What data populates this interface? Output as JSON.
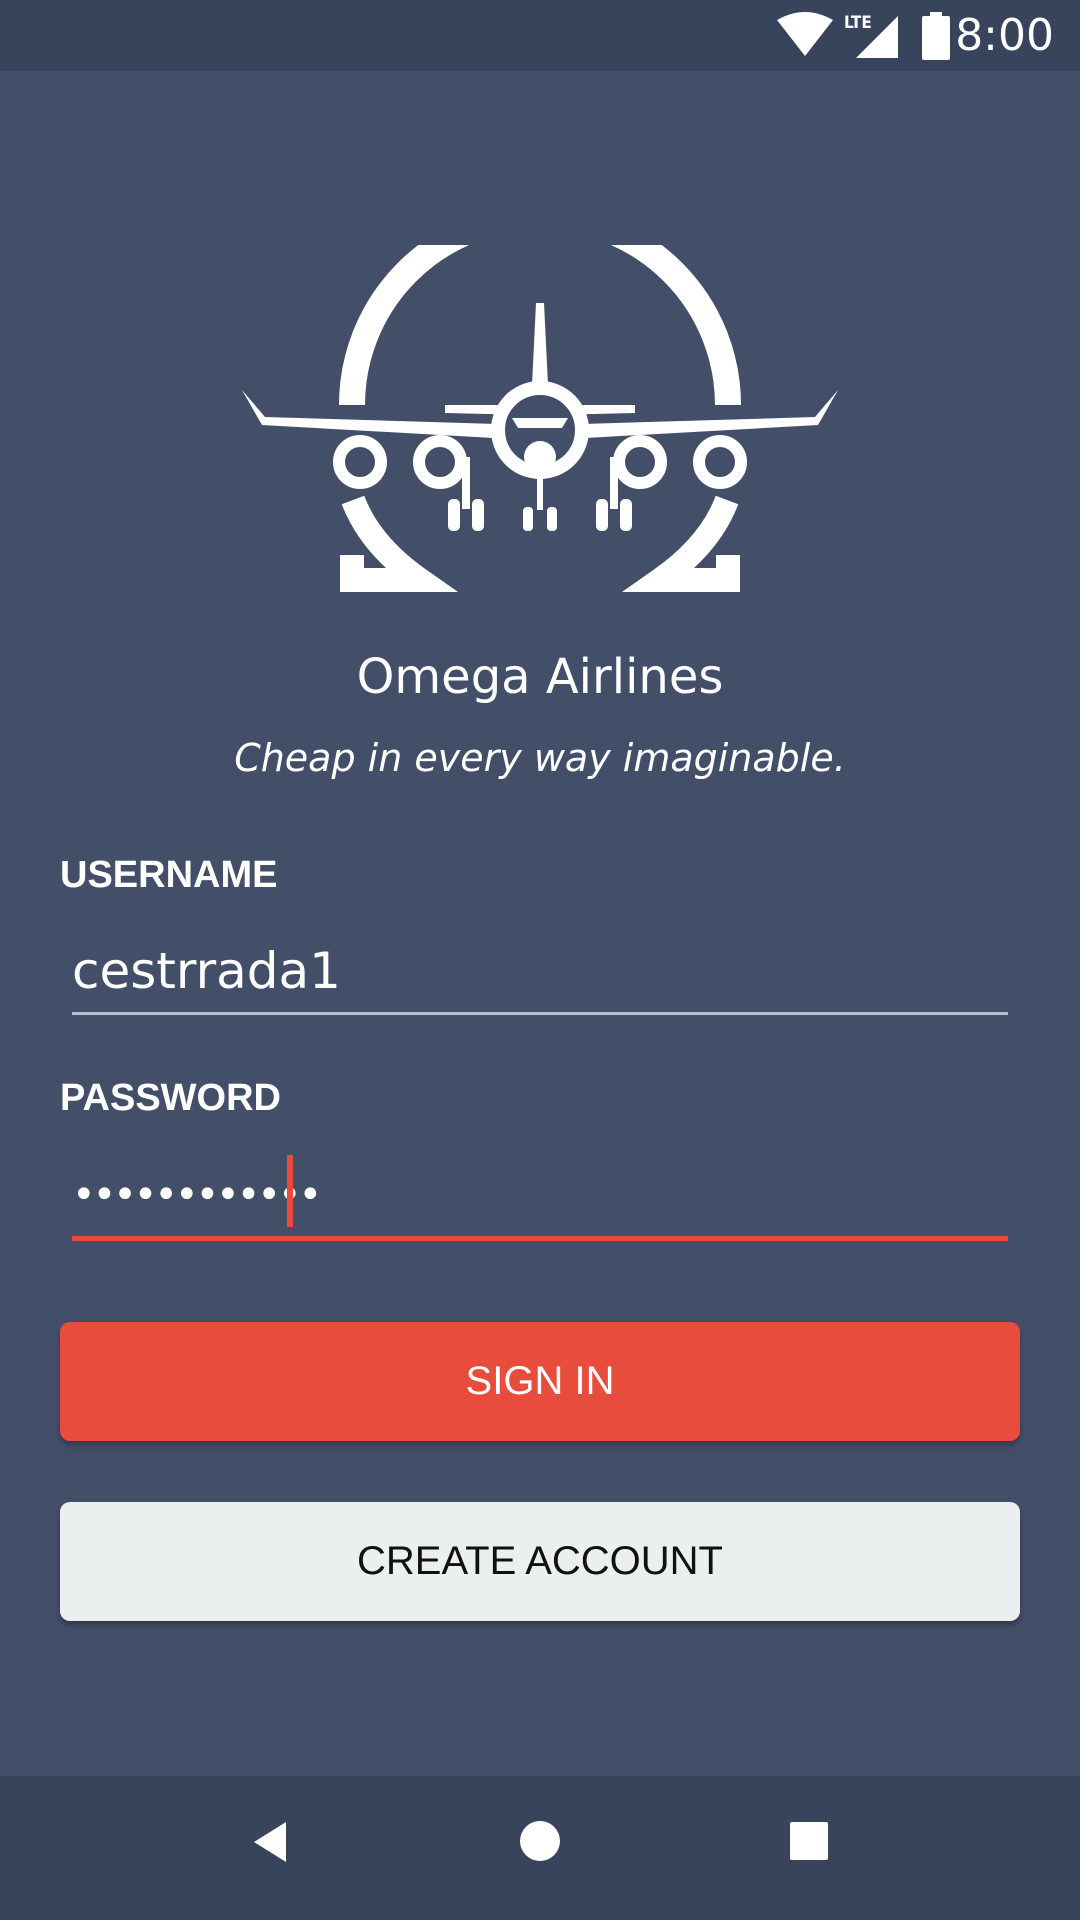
{
  "status_bar": {
    "time": "8:00",
    "network_label": "LTE",
    "icons": [
      "wifi-icon",
      "lte-signal-icon",
      "battery-icon"
    ]
  },
  "app": {
    "logo_icon": "airplane-omega-logo-icon",
    "title": "Omega Airlines",
    "tagline": "Cheap in every way imaginable."
  },
  "form": {
    "username_label": "USERNAME",
    "username_value": "cestrrada1",
    "password_label": "PASSWORD",
    "password_value": "••••••••••••"
  },
  "buttons": {
    "sign_in": "SIGN IN",
    "create_account": "CREATE ACCOUNT"
  },
  "nav_bar": {
    "icons": [
      "back-icon",
      "home-icon",
      "recents-icon"
    ]
  },
  "colors": {
    "background": "#434f69",
    "bars": "#38445b",
    "accent": "#e74c3c",
    "secondary_button": "#eceff0"
  }
}
